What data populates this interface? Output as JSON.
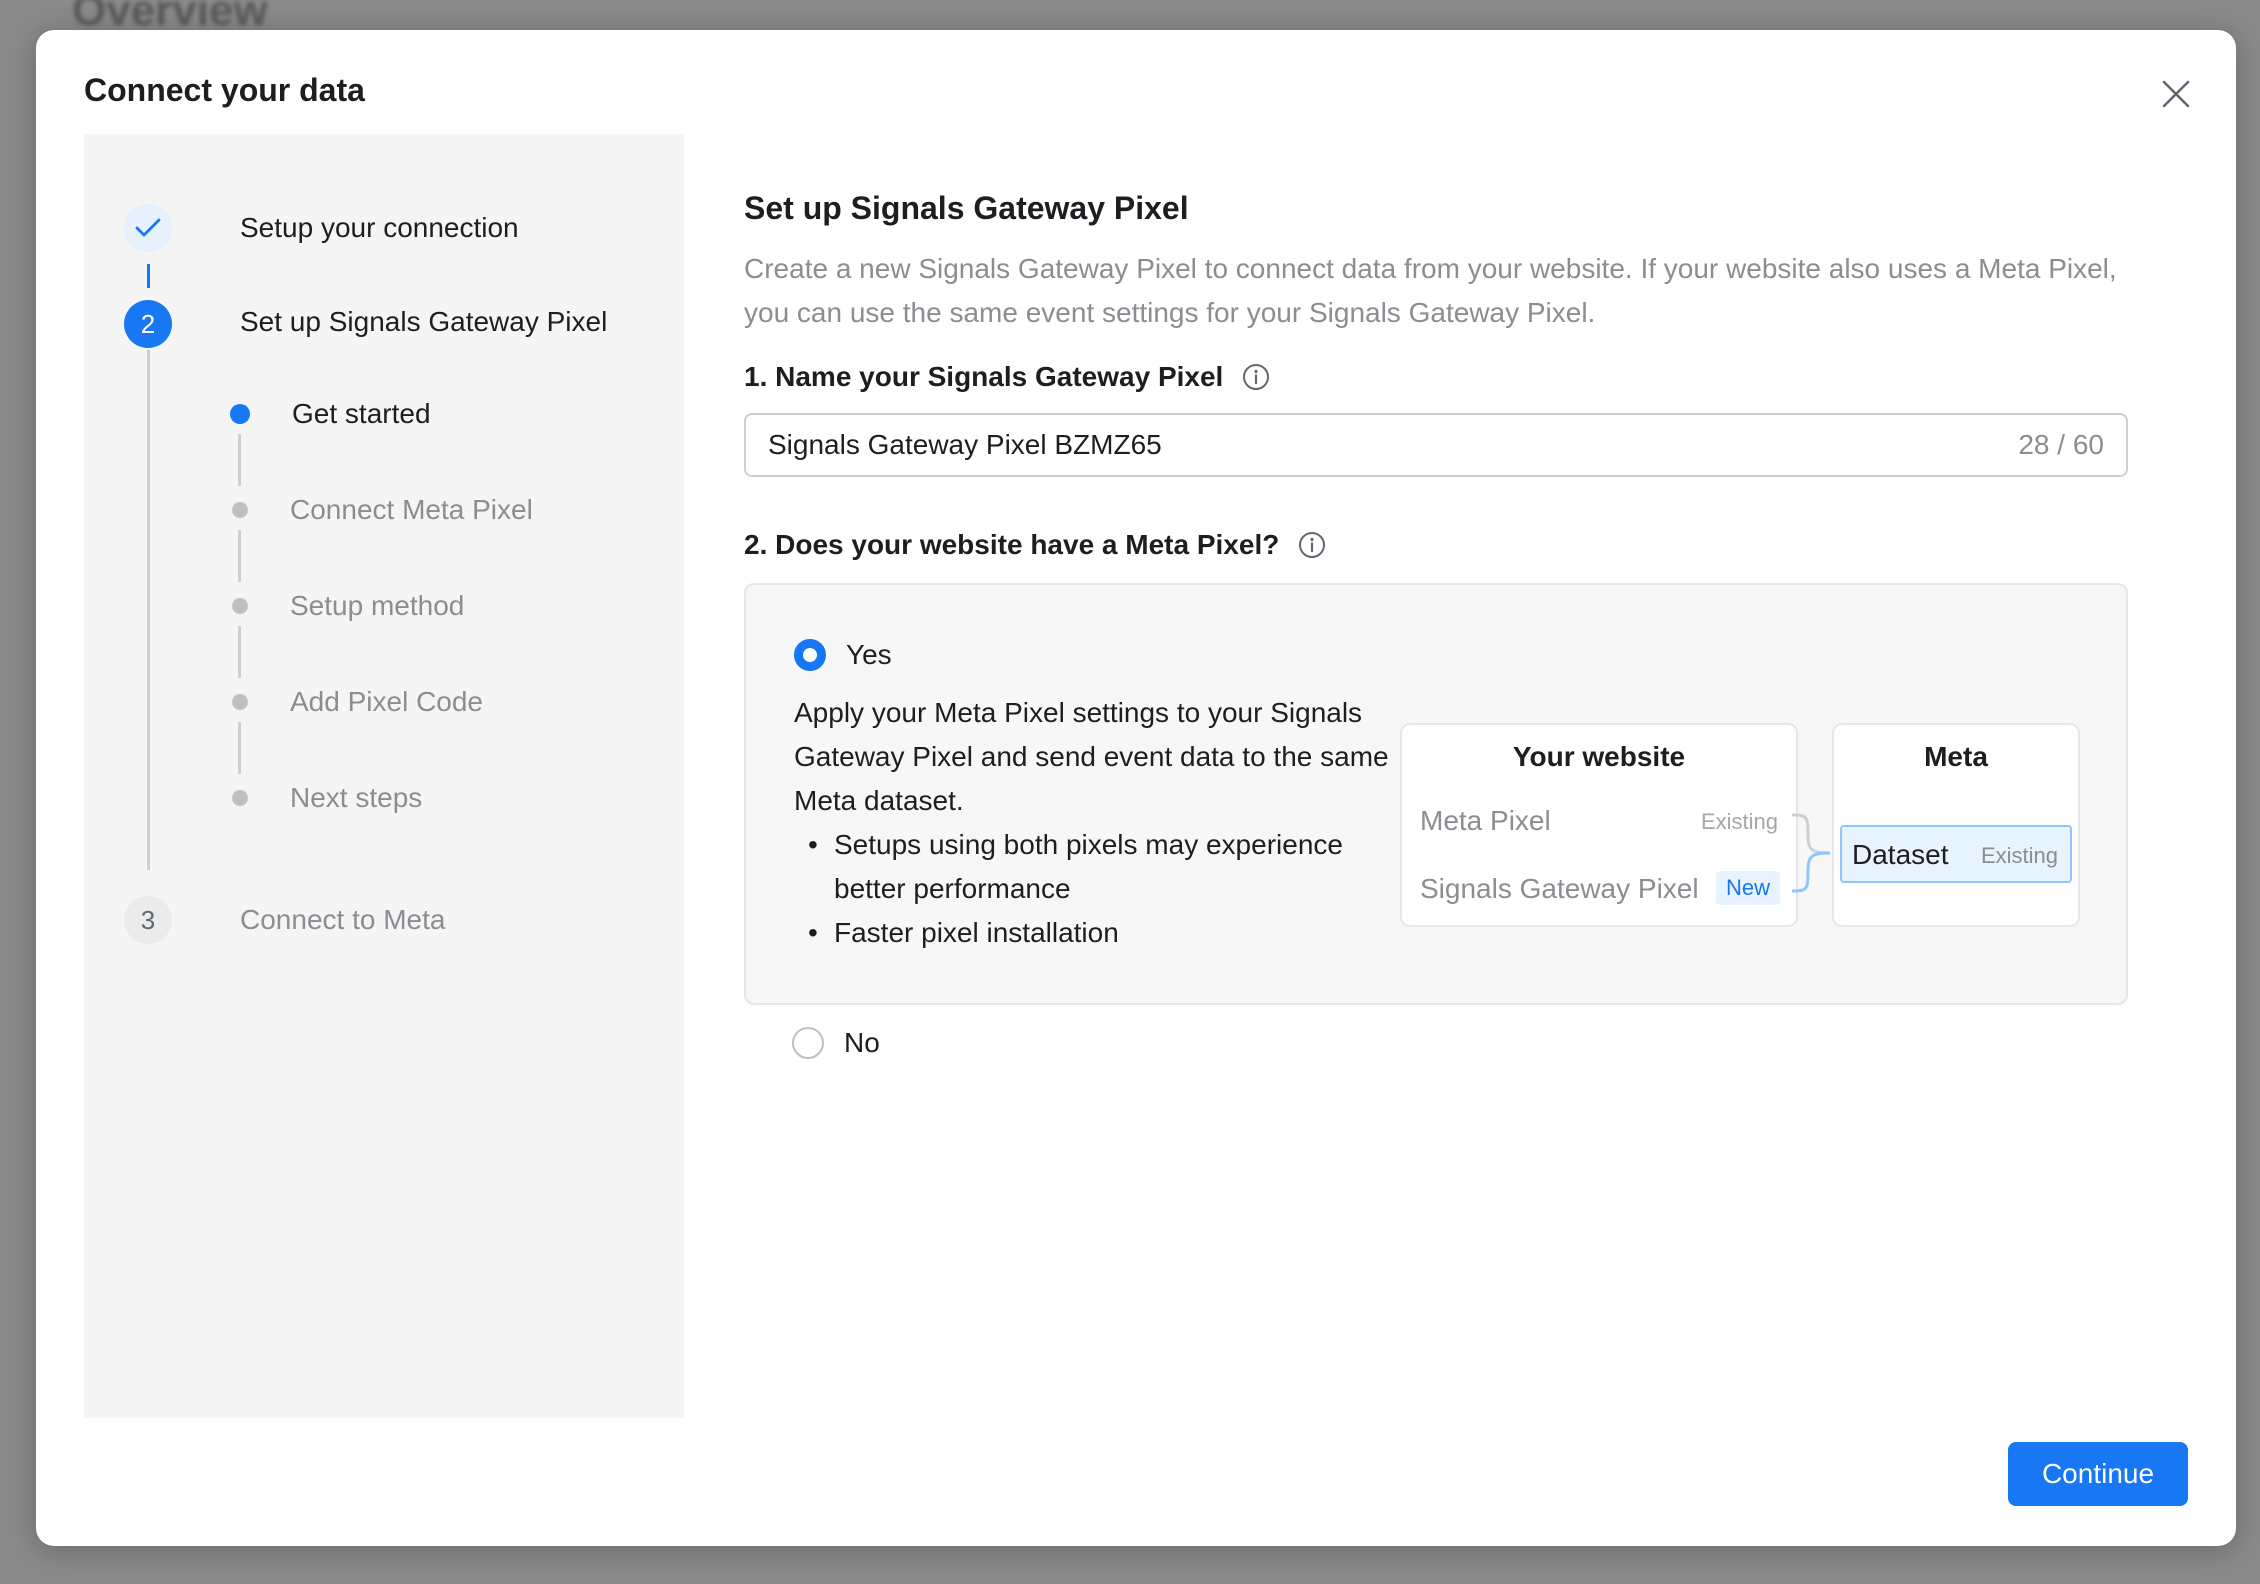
{
  "background": {
    "title": "Overview"
  },
  "modal": {
    "title": "Connect your data",
    "close_icon": "close-icon",
    "continue_label": "Continue"
  },
  "stepper": {
    "steps": [
      {
        "number": "",
        "label": "Setup your connection",
        "state": "done"
      },
      {
        "number": "2",
        "label": "Set up Signals Gateway Pixel",
        "state": "active"
      },
      {
        "number": "3",
        "label": "Connect to Meta",
        "state": "todo"
      }
    ],
    "substeps": [
      {
        "label": "Get started",
        "state": "active"
      },
      {
        "label": "Connect Meta Pixel",
        "state": "todo"
      },
      {
        "label": "Setup method",
        "state": "todo"
      },
      {
        "label": "Add Pixel Code",
        "state": "todo"
      },
      {
        "label": "Next steps",
        "state": "todo"
      }
    ]
  },
  "content": {
    "heading": "Set up Signals Gateway Pixel",
    "description": "Create a new Signals Gateway Pixel to connect data from your website. If your website also uses a Meta Pixel, you can use the same event settings for your Signals Gateway Pixel.",
    "name_field": {
      "label": "1. Name your Signals Gateway Pixel",
      "value": "Signals Gateway Pixel BZMZ65",
      "counter": "28 / 60"
    },
    "pixel_question": {
      "label": "2. Does your website have a Meta Pixel?",
      "yes": {
        "label": "Yes",
        "selected": true,
        "description": "Apply your Meta Pixel settings to your Signals Gateway Pixel and send event data to the same Meta dataset.",
        "bullets": [
          "Setups using both pixels may experience better performance",
          "Faster pixel installation"
        ]
      },
      "no": {
        "label": "No",
        "selected": false
      }
    },
    "diagram": {
      "website_title": "Your website",
      "meta_pixel": "Meta Pixel",
      "meta_pixel_tag": "Existing",
      "gateway_pixel": "Signals Gateway Pixel",
      "gateway_pixel_tag": "New",
      "meta_title": "Meta",
      "dataset": "Dataset",
      "dataset_tag": "Existing"
    }
  },
  "colors": {
    "accent": "#1877f2",
    "muted_text": "#8a8d91",
    "panel_bg": "#f5f5f5"
  }
}
